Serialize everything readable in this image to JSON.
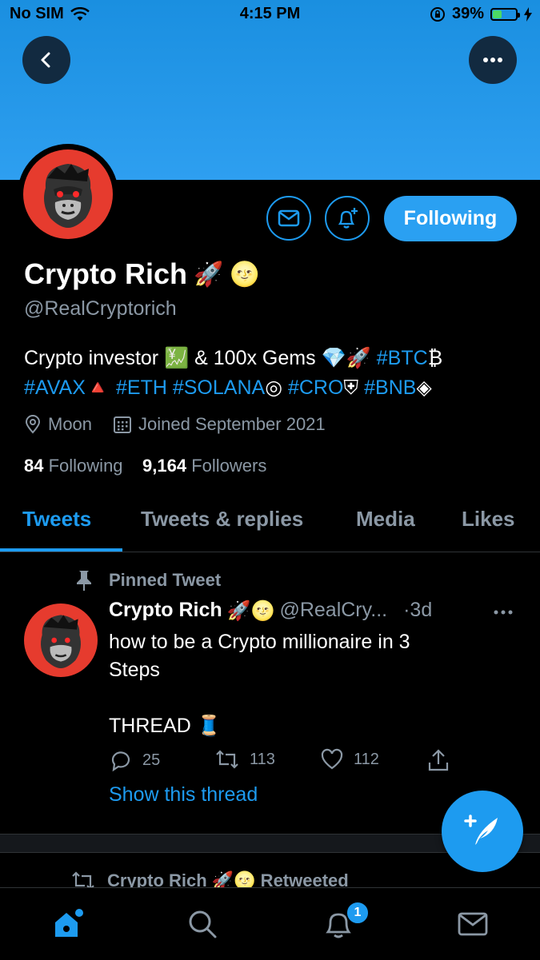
{
  "status_bar": {
    "carrier": "No SIM",
    "time": "4:15 PM",
    "battery_percent": "39%",
    "battery_level": 0.39
  },
  "profile": {
    "name": "Crypto Rich",
    "name_emojis": [
      "🚀",
      "🌝"
    ],
    "handle": "@RealCryptorich",
    "follow_button": "Following",
    "bio_lines": [
      [
        {
          "t": "Crypto investor ",
          "tag": false
        },
        {
          "t": "💹",
          "tag": false
        },
        {
          "t": " & 100x Gems ",
          "tag": false
        },
        {
          "t": "💎🚀",
          "tag": false
        },
        {
          "t": " #BTC",
          "tag": true
        },
        {
          "t": "₿",
          "tag": false
        }
      ],
      [
        {
          "t": "#AVAX",
          "tag": true
        },
        {
          "t": "🔺",
          "tag": false
        },
        {
          "t": " #ETH #SOLANA",
          "tag": true
        },
        {
          "t": "◎",
          "tag": false
        },
        {
          "t": " #CRO",
          "tag": true
        },
        {
          "t": "⛨",
          "tag": false
        },
        {
          "t": " #BNB",
          "tag": true
        },
        {
          "t": "◈",
          "tag": false
        }
      ]
    ],
    "location": "Moon",
    "joined": "Joined September 2021",
    "following_count": "84",
    "following_label": "Following",
    "followers_count": "9,164",
    "followers_label": "Followers"
  },
  "tabs": [
    "Tweets",
    "Tweets & replies",
    "Media",
    "Likes"
  ],
  "pinned_tweet": {
    "pinned_label": "Pinned Tweet",
    "author": "Crypto Rich",
    "author_emojis": "🚀🌝",
    "handle": "@RealCry...",
    "time": "·3d",
    "text": "how to be a Crypto millionaire in 3\nSteps\n\nTHREAD 🧵",
    "replies": "25",
    "retweets": "113",
    "likes": "112",
    "show_thread": "Show this thread"
  },
  "next_tweet": {
    "retweet_label": "Crypto Rich 🚀🌝 Retweeted"
  },
  "nav": {
    "notification_badge": "1"
  },
  "colors": {
    "accent": "#1d9bf0",
    "banner": "#2e9ff0",
    "avatar_bg": "#e63b2e"
  }
}
